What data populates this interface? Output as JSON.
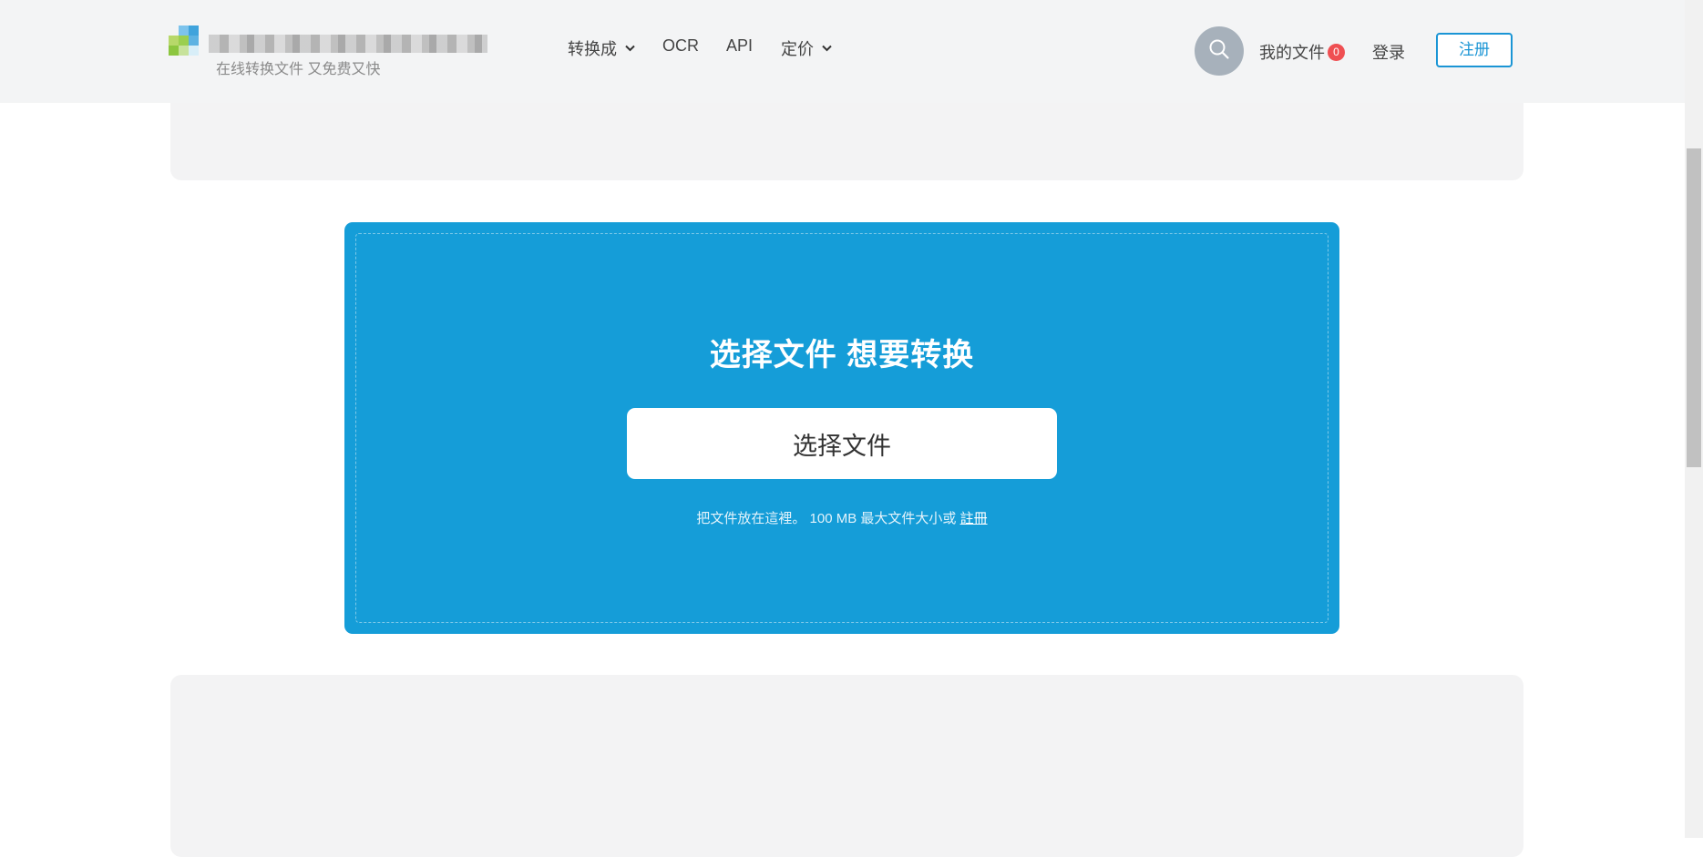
{
  "header": {
    "tagline": "在线转换文件 又免费又快",
    "nav": {
      "convert": "转换成",
      "ocr": "OCR",
      "api": "API",
      "pricing": "定价"
    },
    "my_files_label": "我的文件",
    "my_files_count": "0",
    "login": "登录",
    "register": "注册"
  },
  "upload": {
    "title": "选择文件 想要转换",
    "button": "选择文件",
    "hint_prefix": "把文件放在這裡。 100 MB 最大文件大小或",
    "hint_link": "註冊"
  },
  "colors": {
    "header_bg": "#f3f4f5",
    "accent": "#1a95d5",
    "upload_bg": "#159dd8",
    "badge": "#ef4f52"
  },
  "icons": [
    "search-icon",
    "chevron-down-icon"
  ]
}
